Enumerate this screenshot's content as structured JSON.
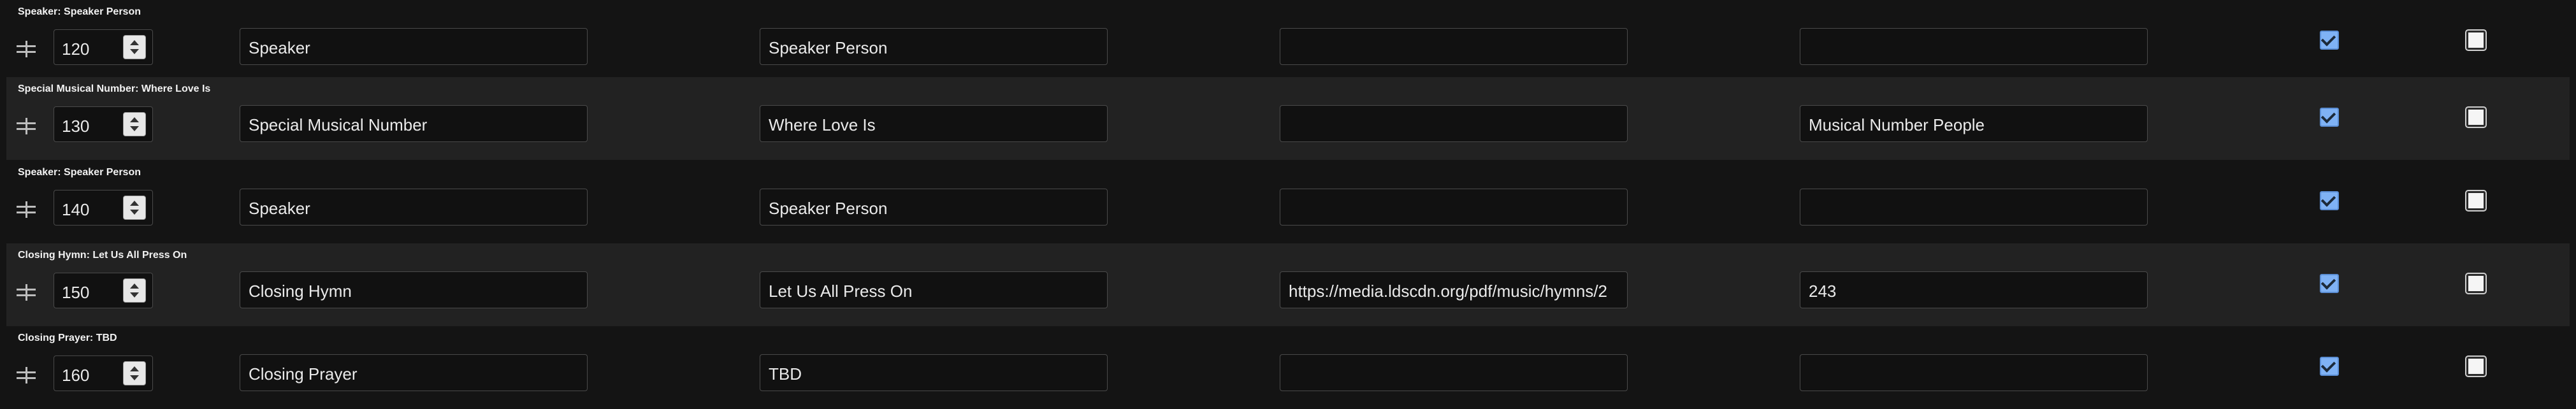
{
  "rows": [
    {
      "title": "Speaker: Speaker Person",
      "order": "120",
      "type": "Speaker",
      "name": "Speaker Person",
      "link": "",
      "extra": "",
      "checked_a": true,
      "checked_b": false
    },
    {
      "title": "Special Musical Number: Where Love Is",
      "order": "130",
      "type": "Special Musical Number",
      "name": "Where Love Is",
      "link": "",
      "extra": "Musical Number People",
      "checked_a": true,
      "checked_b": false
    },
    {
      "title": "Speaker: Speaker Person",
      "order": "140",
      "type": "Speaker",
      "name": "Speaker Person",
      "link": "",
      "extra": "",
      "checked_a": true,
      "checked_b": false
    },
    {
      "title": "Closing Hymn: Let Us All Press On",
      "order": "150",
      "type": "Closing Hymn",
      "name": "Let Us All Press On",
      "link": "https://media.ldscdn.org/pdf/music/hymns/2",
      "extra": "243",
      "checked_a": true,
      "checked_b": false
    },
    {
      "title": "Closing Prayer: TBD",
      "order": "160",
      "type": "Closing Prayer",
      "name": "TBD",
      "link": "",
      "extra": "",
      "checked_a": true,
      "checked_b": false
    }
  ],
  "colors": {
    "checkbox_checked": "#7fb2f5",
    "row_alt_bg": "#222222",
    "page_bg": "#141414"
  },
  "icons": {
    "drag": "drag-handle-icon",
    "spin": "spinner-arrows-icon",
    "check": "checkmark-icon"
  }
}
